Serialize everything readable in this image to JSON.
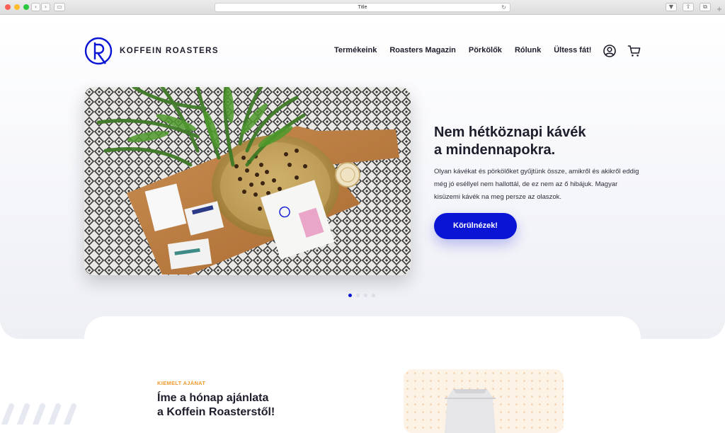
{
  "browser": {
    "title": "Title",
    "back_icon": "chevron-left-icon",
    "forward_icon": "chevron-right-icon"
  },
  "brand": {
    "name": "KOFFEIN ROASTERS",
    "accent": "#0a14d4",
    "orange": "#ef9a2c"
  },
  "nav": {
    "items": [
      "Termékeink",
      "Roasters Magazin",
      "Pörkölők",
      "Rólunk",
      "Ültess fát!"
    ],
    "account_icon": "user-circle-icon",
    "cart_icon": "cart-icon"
  },
  "hero": {
    "title_line1": "Nem hétköznapi kávék",
    "title_line2": "a mindennapokra.",
    "description": "Olyan kávékat és pörkölőket gyűjtünk össze, amikről és akikről eddig még jó eséllyel nem hallottál, de ez nem az ő hibájuk. Magyar kisüzemi kávék na meg persze az olaszok.",
    "cta_label": "Körülnézek!",
    "slides": 4,
    "active_slide": 1
  },
  "featured": {
    "kicker": "KIEMELT AJÁNAT",
    "title_line1": "Íme a hónap ajánlata",
    "title_line2": "a Koffein Roasterstől!"
  }
}
